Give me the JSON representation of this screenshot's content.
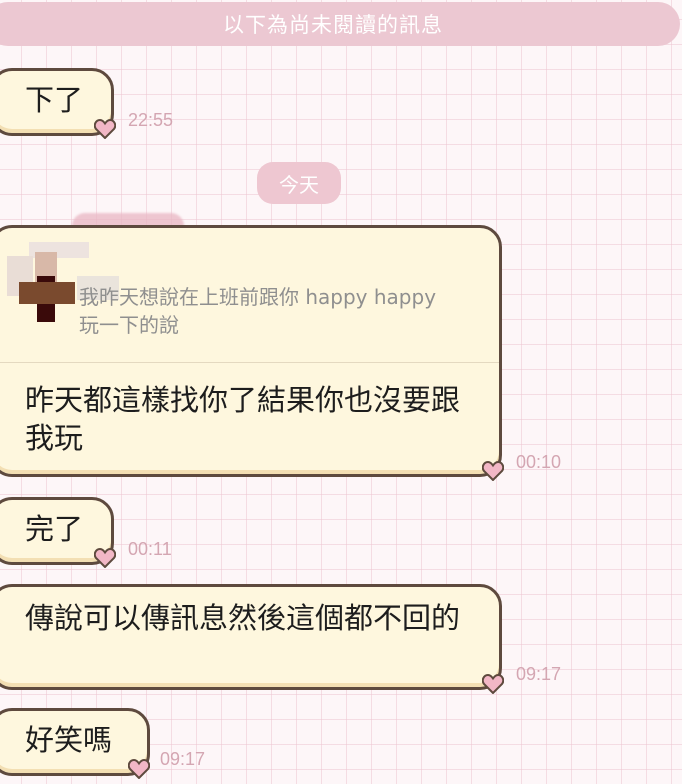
{
  "banner": {
    "text": "以下為尚未閱讀的訊息"
  },
  "date_chip": {
    "label": "今天"
  },
  "messages": [
    {
      "text": "下了",
      "time": "22:55"
    },
    {
      "quote": "我昨天想說在上班前跟你 happy happy 玩一下的說",
      "text": "昨天都這樣找你了結果你也沒要跟我玩",
      "time": "00:10"
    },
    {
      "text": "完了",
      "time": "00:11"
    },
    {
      "text": "傳說可以傳訊息然後這個都不回的",
      "time": "09:17"
    },
    {
      "text": "好笑嗎",
      "time": "09:17"
    }
  ],
  "icons": {
    "bubble_tail": "heart-icon",
    "quote_avatar": "blurred-avatar-icon"
  },
  "colors": {
    "background": "#fdf6f8",
    "grid": "#eec6d2",
    "banner": "#ecc8d2",
    "bubble_fill": "#fef7de",
    "bubble_border": "#5e4a3e",
    "timestamp": "#d4a6b2",
    "heart": "#f2b7c6"
  }
}
